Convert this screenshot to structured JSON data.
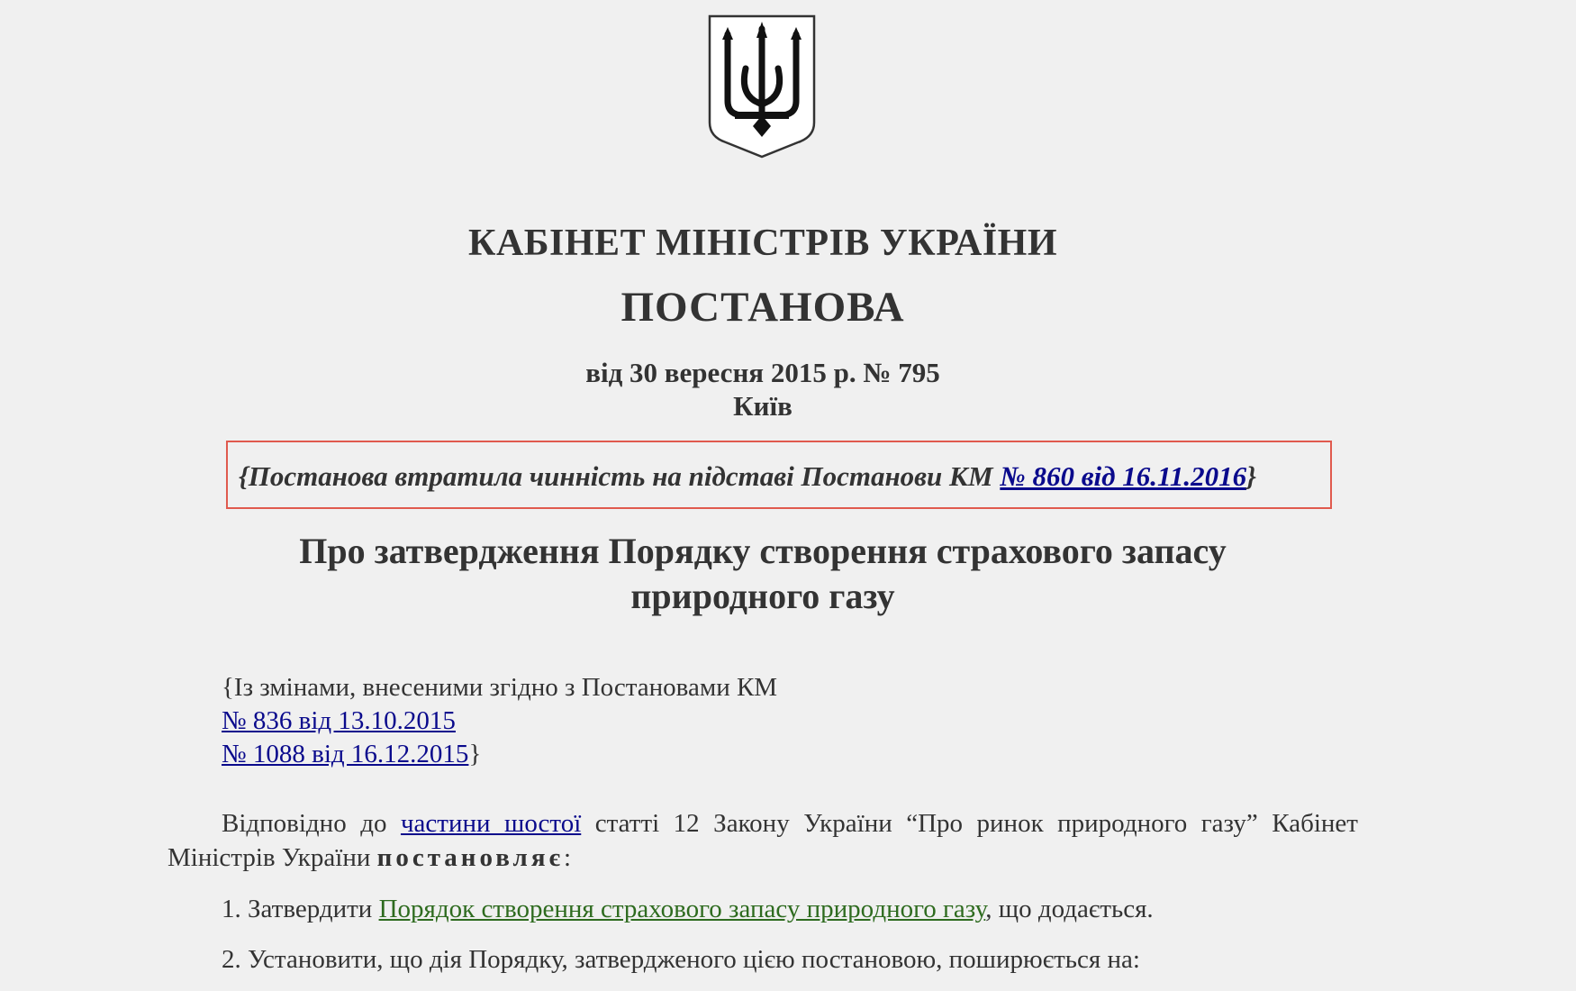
{
  "document": {
    "authority": "КАБІНЕТ МІНІСТРІВ УКРАЇНИ",
    "type": "ПОСТАНОВА",
    "date_line": "від 30 вересня 2015 р. № 795",
    "city": "Київ",
    "invalid_notice": {
      "text_before": "{Постанова втратила чинність на підставі Постанови КМ ",
      "link": "№ 860 від 16.11.2016",
      "text_after": "}"
    },
    "title": "Про затвердження Порядку створення страхового запасу природного газу",
    "amendments": {
      "intro": "{Із змінами, внесеними згідно з Постановами КМ",
      "links": [
        "№ 836 від 13.10.2015",
        "№ 1088 від 16.12.2015"
      ],
      "closing": "}"
    },
    "basis": {
      "text_before": "Відповідно до ",
      "link": "частини шостої",
      "text_after": " статті 12 Закону України “Про ринок природного газу” Кабінет Міністрів України ",
      "emphasis": "постановляє",
      "ending": ":"
    },
    "item1": {
      "text_before": "1. Затвердити ",
      "link": "Порядок створення страхового запасу природного газу",
      "text_after": ", що додається."
    },
    "item2": {
      "text": "2. Установити, що дія Порядку, затвердженого цією постановою, поширюється на:"
    }
  },
  "colors": {
    "background": "#f0f0f0",
    "text": "#333333",
    "link": "#0a0a8c",
    "green_link": "#2e6b1f",
    "notice_border": "#e05a4e"
  },
  "icons": {
    "emblem": "coat-of-arms-of-ukraine-icon"
  }
}
